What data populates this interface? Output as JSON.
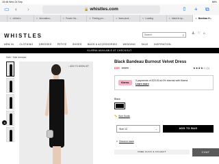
{
  "status_bar": {
    "time": "15:48  Wed 24 Sep",
    "battery": "86%"
  },
  "browser": {
    "url": "whistles.com",
    "tabs": [
      {
        "label": "citi.tsd.u",
        "active": false
      },
      {
        "label": "Annotation...",
        "active": false
      },
      {
        "label": "Frozen Ha...",
        "active": false
      },
      {
        "label": "Finding pro...",
        "active": false
      },
      {
        "label": "team pizol...",
        "active": false
      },
      {
        "label": "Loading",
        "active": false
      },
      {
        "label": "black tri-sp...",
        "active": false
      },
      {
        "label": "Bandeau H...",
        "active": true
      }
    ]
  },
  "header": {
    "logo": "WHISTLES",
    "search_placeholder": "Search",
    "nav": [
      "NEW IN",
      "CLOTHING",
      "DRESSES",
      "PETITE",
      "SHOES",
      "BAGS & ACCESSORIES",
      "WEDDING",
      "SALE",
      "INSPIRATION"
    ],
    "banner": "KLARNA AVAILABLE AT CHECKOUT"
  },
  "breadcrumb": "Sale / Sale dresses",
  "gallery": {
    "wishlist_label": "ADD TO WISHLIST",
    "thumbnail_count": 5
  },
  "product": {
    "title": "Black Bandeau Burnout Velvet Dress",
    "price_now": "£69",
    "price_was": "£229",
    "rating_stars": "★★★★☆",
    "rating_count": "(1)",
    "klarna_logo": "Klarna.",
    "klarna_text": "3 payments of £23.00 at 0% interest with Klarna",
    "klarna_link": "Learn more",
    "colour_label": "Black",
    "size_guide": "Size Guide",
    "size_value": "Size 12",
    "add_to_bag": "ADD TO BAG",
    "stock_link": "Check in store",
    "click_collect": "FREE CLICK & COLLECT",
    "chat": "CHAT"
  }
}
